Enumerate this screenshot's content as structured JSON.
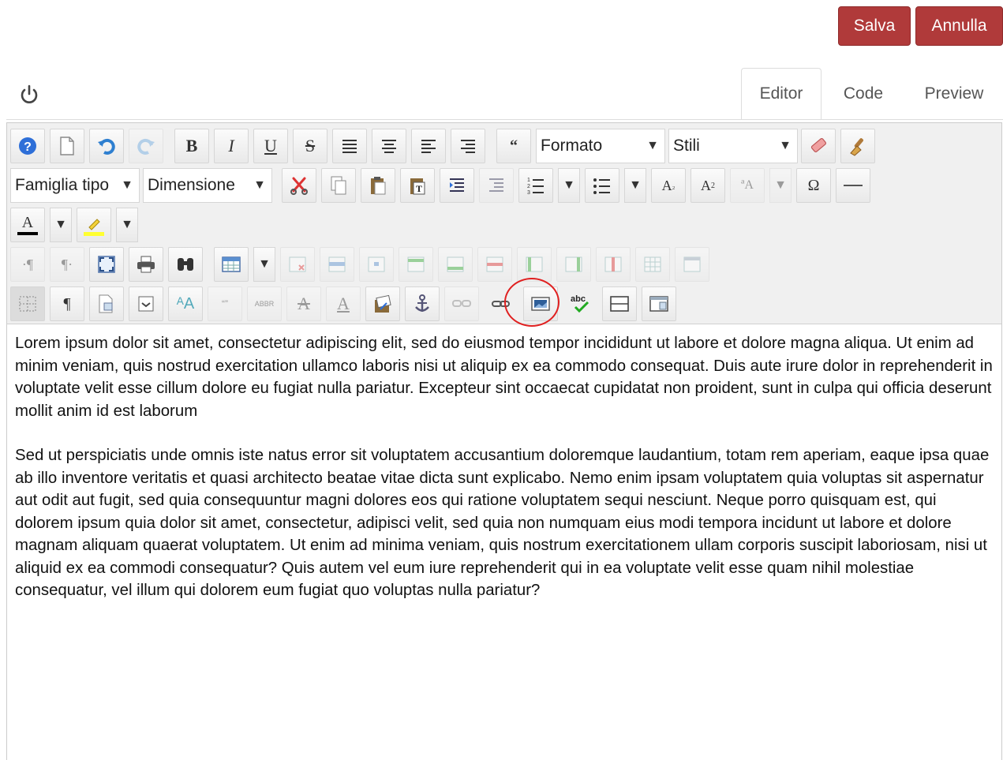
{
  "actions": {
    "save_label": "Salva",
    "cancel_label": "Annulla"
  },
  "tabs": [
    {
      "label": "Editor",
      "active": true
    },
    {
      "label": "Code",
      "active": false
    },
    {
      "label": "Preview",
      "active": false
    }
  ],
  "toolbar": {
    "format_value": "Formato",
    "styles_value": "Stili",
    "font_family_value": "Famiglia tipo",
    "font_size_value": "Dimensione",
    "highlighted_tool": "image-icon"
  },
  "colors": {
    "accent": "#b03a3a",
    "highlight_circle": "#e02020",
    "toolbar_bg": "#f0f0f0"
  },
  "content": {
    "paragraphs": [
      "Lorem ipsum dolor sit amet, consectetur adipiscing elit, sed do eiusmod tempor incididunt ut labore et dolore magna aliqua. Ut enim ad minim veniam, quis nostrud exercitation ullamco laboris nisi ut aliquip ex ea commodo consequat. Duis aute irure dolor in reprehenderit in voluptate velit esse cillum dolore eu fugiat nulla pariatur. Excepteur sint occaecat cupidatat non proident, sunt in culpa qui officia deserunt mollit anim id est laborum",
      "Sed ut perspiciatis unde omnis iste natus error sit voluptatem accusantium doloremque laudantium, totam rem aperiam, eaque ipsa quae ab illo inventore veritatis et quasi architecto beatae vitae dicta sunt explicabo. Nemo enim ipsam voluptatem quia voluptas sit aspernatur aut odit aut fugit, sed quia consequuntur magni dolores eos qui ratione voluptatem sequi nesciunt. Neque porro quisquam est, qui dolorem ipsum quia dolor sit amet, consectetur, adipisci velit, sed quia non numquam eius modi tempora incidunt ut labore et dolore magnam aliquam quaerat voluptatem. Ut enim ad minima veniam, quis nostrum exercitationem ullam corporis suscipit laboriosam, nisi ut aliquid ex ea commodi consequatur? Quis autem vel eum iure reprehenderit qui in ea voluptate velit esse quam nihil molestiae consequatur, vel illum qui dolorem eum fugiat quo voluptas nulla pariatur?"
    ]
  }
}
